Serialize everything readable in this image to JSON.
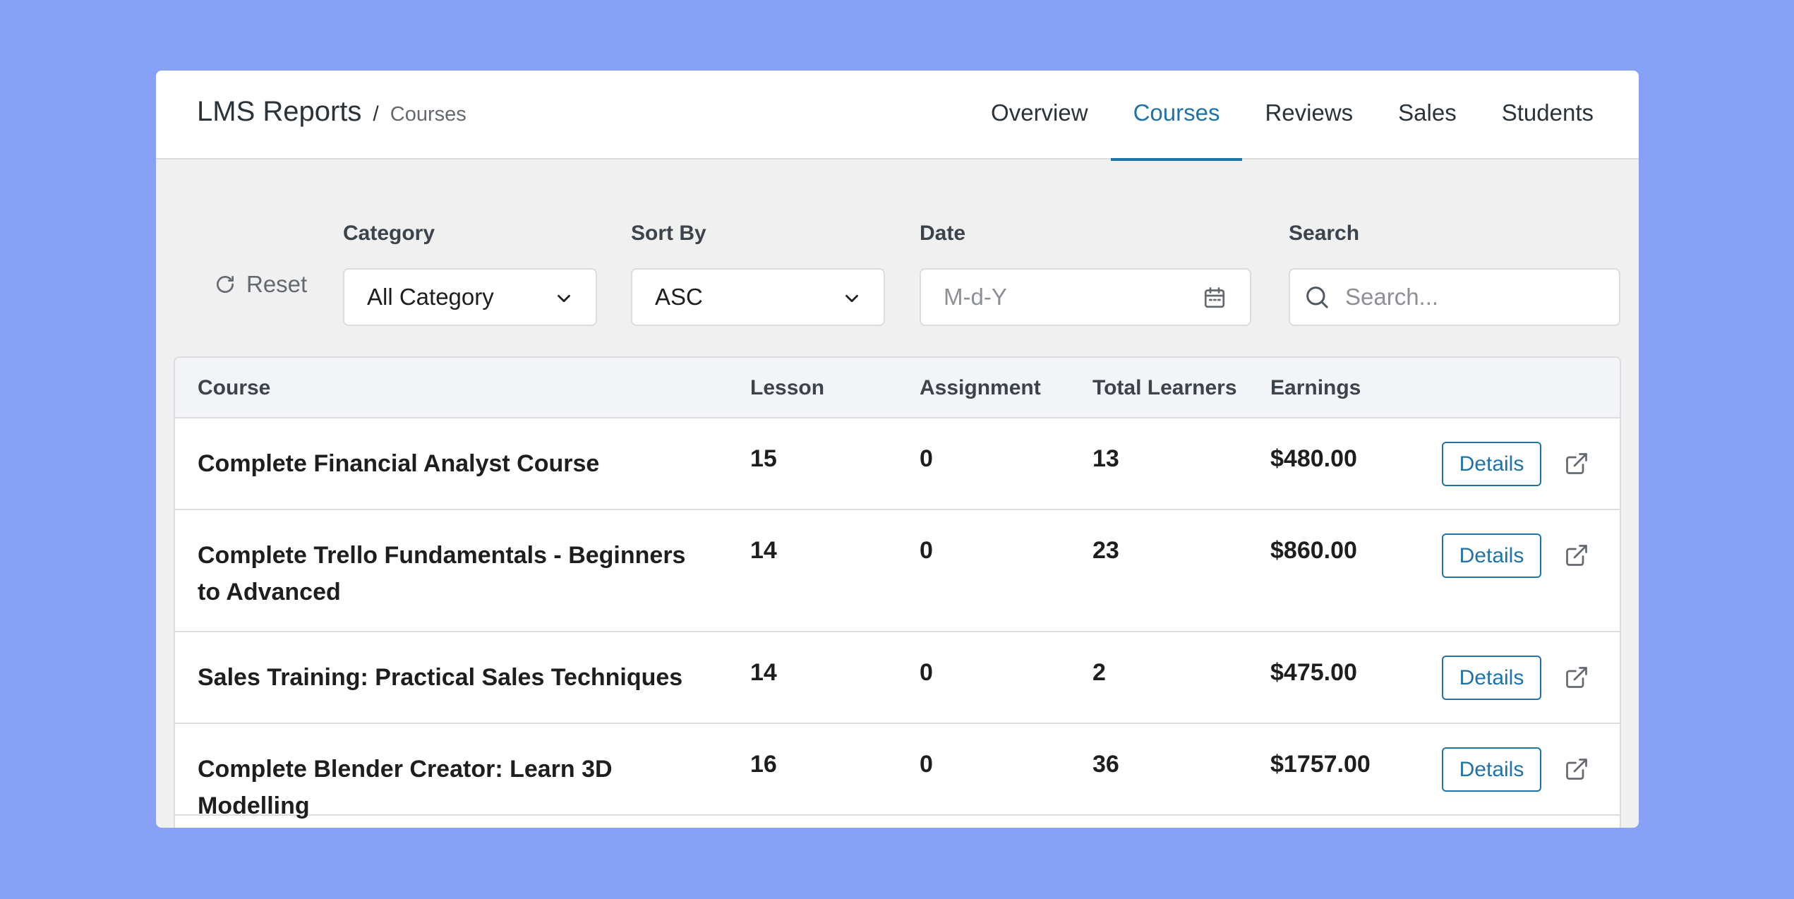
{
  "header": {
    "title": "LMS Reports",
    "separator": "/",
    "current": "Courses",
    "tabs": [
      {
        "label": "Overview",
        "active": false
      },
      {
        "label": "Courses",
        "active": true
      },
      {
        "label": "Reviews",
        "active": false
      },
      {
        "label": "Sales",
        "active": false
      },
      {
        "label": "Students",
        "active": false
      }
    ]
  },
  "filters": {
    "reset_label": "Reset",
    "category": {
      "label": "Category",
      "value": "All Category"
    },
    "sort_by": {
      "label": "Sort By",
      "value": "ASC"
    },
    "date": {
      "label": "Date",
      "placeholder": "M-d-Y"
    },
    "search": {
      "label": "Search",
      "placeholder": "Search..."
    }
  },
  "table": {
    "columns": [
      "Course",
      "Lesson",
      "Assignment",
      "Total Learners",
      "Earnings"
    ],
    "rows": [
      {
        "course": "Complete Financial Analyst Course",
        "lesson": "15",
        "assignment": "0",
        "learners": "13",
        "earnings": "$480.00"
      },
      {
        "course": "Complete Trello Fundamentals - Beginners to Advanced",
        "lesson": "14",
        "assignment": "0",
        "learners": "23",
        "earnings": "$860.00"
      },
      {
        "course": "Sales Training: Practical Sales Techniques",
        "lesson": "14",
        "assignment": "0",
        "learners": "2",
        "earnings": "$475.00"
      },
      {
        "course": "Complete Blender Creator: Learn 3D Modelling",
        "lesson": "16",
        "assignment": "0",
        "learners": "36",
        "earnings": "$1757.00"
      }
    ],
    "details_label": "Details"
  },
  "colors": {
    "accent": "#1e73a8",
    "background": "#86a1f6"
  },
  "icons": [
    "reset-icon",
    "chevron-down-icon",
    "calendar-icon",
    "search-icon",
    "external-link-icon"
  ]
}
